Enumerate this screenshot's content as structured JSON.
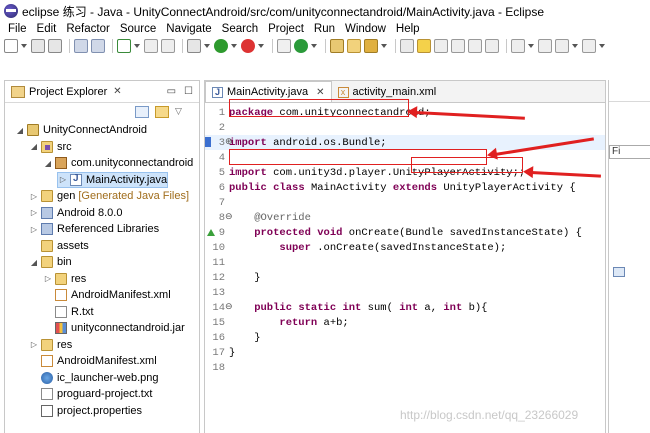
{
  "window": {
    "title": "eclipse  练习 - Java - UnityConnectAndroid/src/com/unityconnectandroid/MainActivity.java - Eclipse"
  },
  "menu": [
    "File",
    "Edit",
    "Refactor",
    "Source",
    "Navigate",
    "Search",
    "Project",
    "Run",
    "Window",
    "Help"
  ],
  "explorer": {
    "title": "Project Explorer",
    "close": "✕",
    "minimize": "▭",
    "maximize": "☐",
    "tree": [
      {
        "twisty": "◢",
        "icon": "project",
        "label": "UnityConnectAndroid",
        "indent": 0
      },
      {
        "twisty": "◢",
        "icon": "srcfolder",
        "label": "src",
        "indent": 1
      },
      {
        "twisty": "◢",
        "icon": "package",
        "label": "com.unityconnectandroid",
        "indent": 2
      },
      {
        "twisty": "▷",
        "icon": "java",
        "label": "MainActivity.java",
        "indent": 3,
        "selected": true
      },
      {
        "twisty": "▷",
        "icon": "folder",
        "label": "gen",
        "extra": "[Generated Java Files]",
        "indent": 1
      },
      {
        "twisty": "▷",
        "icon": "lib",
        "label": "Android 8.0.0",
        "indent": 1
      },
      {
        "twisty": "▷",
        "icon": "lib",
        "label": "Referenced Libraries",
        "indent": 1
      },
      {
        "twisty": "",
        "icon": "folder",
        "label": "assets",
        "indent": 1
      },
      {
        "twisty": "◢",
        "icon": "folder",
        "label": "bin",
        "indent": 1
      },
      {
        "twisty": "▷",
        "icon": "folder",
        "label": "res",
        "indent": 2
      },
      {
        "twisty": "",
        "icon": "xml",
        "label": "AndroidManifest.xml",
        "indent": 2
      },
      {
        "twisty": "",
        "icon": "txt",
        "label": "R.txt",
        "indent": 2
      },
      {
        "twisty": "",
        "icon": "jar",
        "label": "unityconnectandroid.jar",
        "indent": 2
      },
      {
        "twisty": "▷",
        "icon": "folder",
        "label": "res",
        "indent": 1
      },
      {
        "twisty": "",
        "icon": "xml",
        "label": "AndroidManifest.xml",
        "indent": 1
      },
      {
        "twisty": "",
        "icon": "png",
        "label": "ic_launcher-web.png",
        "indent": 1
      },
      {
        "twisty": "",
        "icon": "txt",
        "label": "proguard-project.txt",
        "indent": 1
      },
      {
        "twisty": "",
        "icon": "props",
        "label": "project.properties",
        "indent": 1
      }
    ]
  },
  "editor": {
    "tabs": [
      {
        "label": "MainActivity.java",
        "icon": "J",
        "close": "✕",
        "active": true
      },
      {
        "label": "activity_main.xml",
        "icon": "x",
        "active": false
      }
    ],
    "lines": [
      {
        "n": "1",
        "parts": [
          [
            "kw",
            "package"
          ],
          [
            "",
            "com.unityconnectandroid;"
          ]
        ]
      },
      {
        "n": "2",
        "parts": []
      },
      {
        "n": "3",
        "fold": "⊕",
        "parts": [
          [
            "kw",
            "import"
          ],
          [
            "",
            "android.os.Bundle;"
          ]
        ],
        "hl": true
      },
      {
        "n": "4",
        "parts": []
      },
      {
        "n": "5",
        "parts": [
          [
            "kw",
            "import"
          ],
          [
            "",
            "com.unity3d.player.UnityPlayerActivity;;"
          ]
        ]
      },
      {
        "n": "6",
        "parts": [
          [
            "kw",
            "public"
          ],
          [
            "kw",
            "class"
          ],
          [
            "",
            "MainActivity"
          ],
          [
            "kw",
            "extends"
          ],
          [
            "",
            "UnityPlayerActivity {"
          ]
        ]
      },
      {
        "n": "7",
        "parts": []
      },
      {
        "n": "8",
        "fold": "⊖",
        "parts": [
          [
            "ann",
            "    @Override"
          ]
        ]
      },
      {
        "n": "9",
        "parts": [
          [
            "kw",
            "    protected"
          ],
          [
            "kw",
            "void"
          ],
          [
            "",
            "onCreate(Bundle savedInstanceState) {"
          ]
        ]
      },
      {
        "n": "10",
        "parts": [
          [
            "kw",
            "        super"
          ],
          [
            "",
            ".onCreate(savedInstanceState);"
          ]
        ]
      },
      {
        "n": "11",
        "parts": []
      },
      {
        "n": "12",
        "parts": [
          [
            "",
            "    }"
          ]
        ]
      },
      {
        "n": "13",
        "parts": []
      },
      {
        "n": "14",
        "fold": "⊖",
        "parts": [
          [
            "kw",
            "    public"
          ],
          [
            "kw",
            "static"
          ],
          [
            "kw",
            "int"
          ],
          [
            "",
            "sum("
          ],
          [
            "kw",
            "int"
          ],
          [
            "",
            "a,"
          ],
          [
            "kw",
            "int"
          ],
          [
            "",
            "b){"
          ]
        ]
      },
      {
        "n": "15",
        "parts": [
          [
            "kw",
            "        return"
          ],
          [
            "",
            "a+b;"
          ]
        ]
      },
      {
        "n": "16",
        "parts": [
          [
            "",
            "    }"
          ]
        ]
      },
      {
        "n": "17",
        "parts": [
          [
            "",
            "}"
          ]
        ]
      },
      {
        "n": "18",
        "parts": []
      }
    ]
  },
  "rightpane": {
    "filter_text": "Fi"
  },
  "watermark": "http://blog.csdn.net/qq_23266029"
}
